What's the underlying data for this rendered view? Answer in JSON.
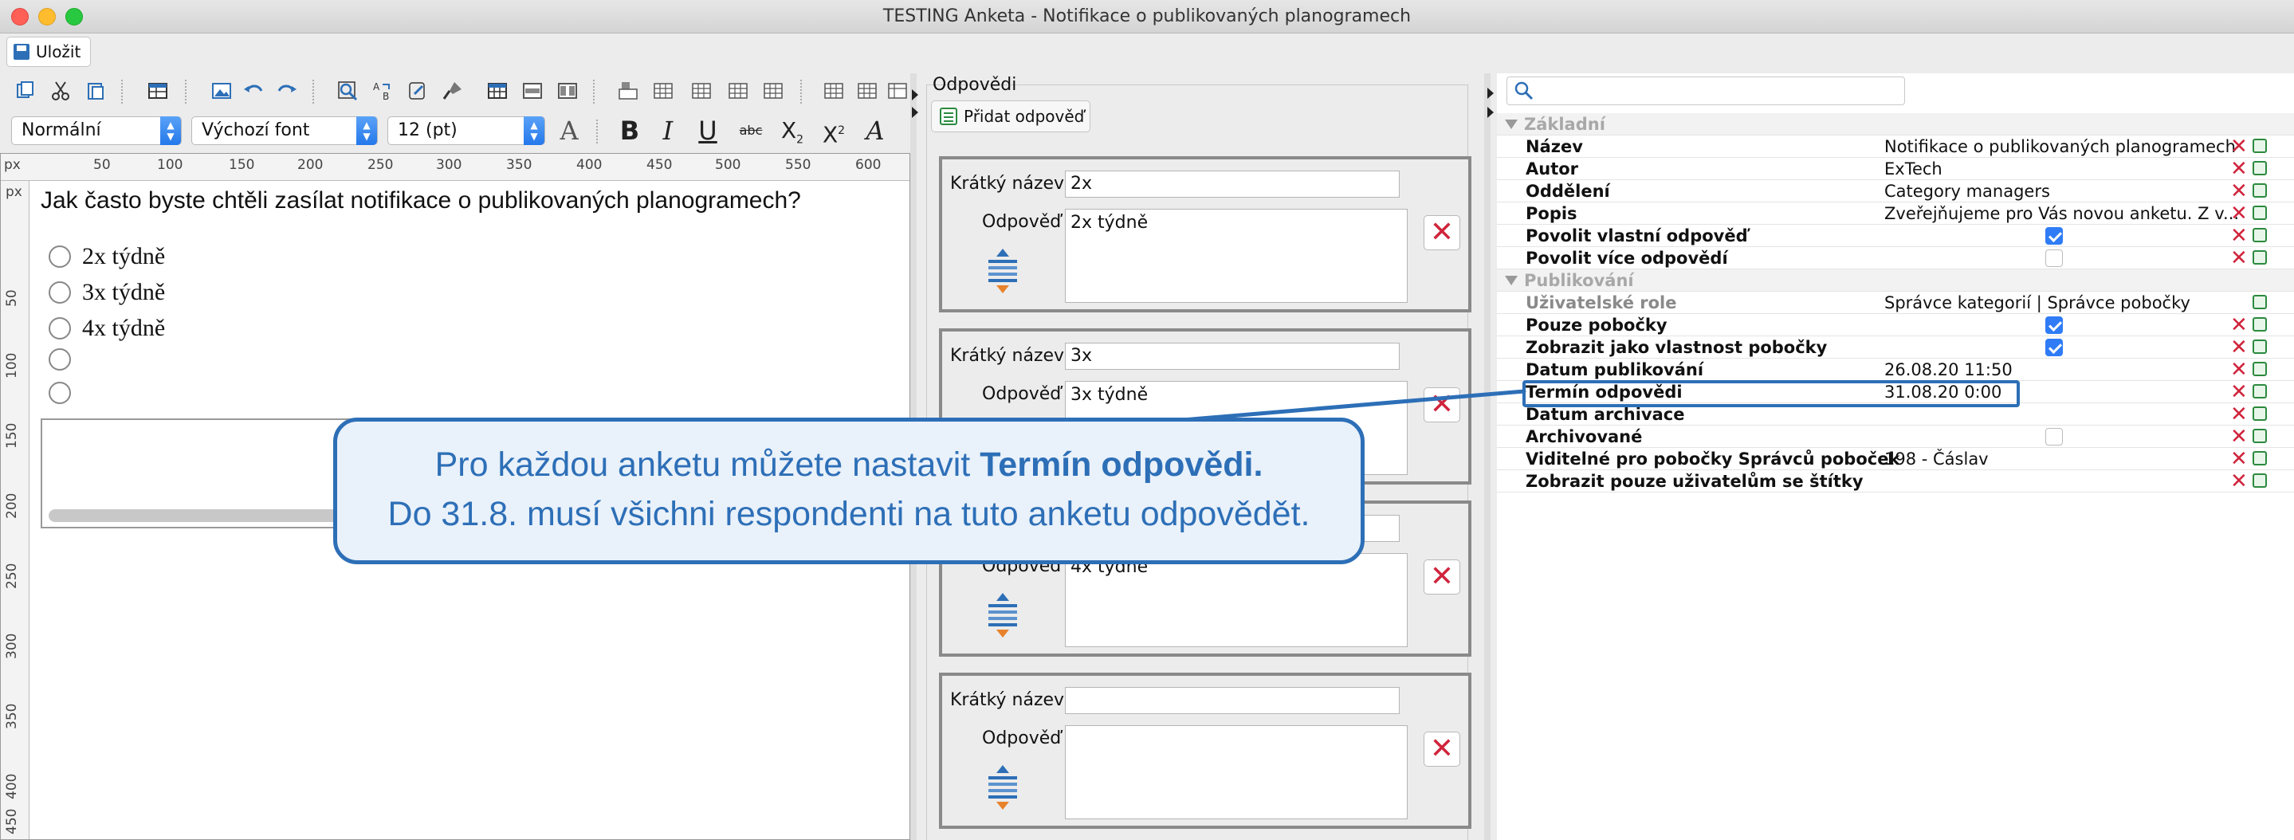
{
  "window": {
    "title": "TESTING Anketa - Notifikace o publikovaných planogramech"
  },
  "toolbar": {
    "save_label": "Uložit"
  },
  "format": {
    "style": "Normální",
    "font": "Výchozí font",
    "size": "12 (pt)"
  },
  "ruler": {
    "unit": "px",
    "top_ticks": [
      "50",
      "100",
      "150",
      "200",
      "250",
      "300",
      "350",
      "400",
      "450",
      "500",
      "550",
      "600"
    ],
    "left_ticks": [
      "50",
      "100",
      "150",
      "200",
      "250",
      "300",
      "350",
      "400",
      "450"
    ]
  },
  "editor": {
    "question": "Jak často byste chtěli zasílat notifikace o publikovaných planogramech?",
    "options": [
      "2x týdně",
      "3x týdně",
      "4x týdně",
      "",
      ""
    ]
  },
  "answers": {
    "title": "Odpovědi",
    "add_label": "Přidat odpověď",
    "short_name_label": "Krátký název",
    "answer_label": "Odpověď",
    "items": [
      {
        "short": "2x",
        "text": "2x týdně"
      },
      {
        "short": "3x",
        "text": "3x týdně"
      },
      {
        "short": "",
        "text": "4x týdně"
      },
      {
        "short": "",
        "text": ""
      }
    ]
  },
  "properties": {
    "search_placeholder": "",
    "groups": [
      {
        "name": "Základní",
        "rows": [
          {
            "key": "Název",
            "value": "Notifikace o publikovaných planogramech"
          },
          {
            "key": "Autor",
            "value": "ExTech"
          },
          {
            "key": "Oddělení",
            "value": "Category managers"
          },
          {
            "key": "Popis",
            "value": "Zveřejňujeme pro Vás novou anketu. Z v..."
          },
          {
            "key": "Povolit vlastní odpověď",
            "check": true
          },
          {
            "key": "Povolit více odpovědí",
            "check": false
          }
        ]
      },
      {
        "name": "Publikování",
        "rows": [
          {
            "key": "Uživatelské role",
            "value": "Správce kategorií | Správce pobočky",
            "disabled": true
          },
          {
            "key": "Pouze pobočky",
            "check": true
          },
          {
            "key": "Zobrazit jako vlastnost pobočky",
            "check": true
          },
          {
            "key": "Datum publikování",
            "value": "26.08.20 11:50"
          },
          {
            "key": "Termín odpovědi",
            "value": "31.08.20 0:00"
          },
          {
            "key": "Datum archivace",
            "value": ""
          },
          {
            "key": "Archivované",
            "check": false
          },
          {
            "key": "Viditelné pro pobočky Správců poboček",
            "value": "198 - Čáslav"
          },
          {
            "key": "Zobrazit pouze uživatelům se štítky",
            "value": ""
          }
        ]
      }
    ]
  },
  "callout": {
    "line1_prefix": "Pro každou anketu můžete nastavit ",
    "line1_bold": "Termín odpovědi.",
    "line2": "Do 31.8. musí všichni respondenti na tuto anketu odpovědět."
  },
  "colors": {
    "accent": "#2d6fb7",
    "danger": "#d0243c",
    "check": "#2f7cf6",
    "callout_bg": "#e9f1fa"
  }
}
